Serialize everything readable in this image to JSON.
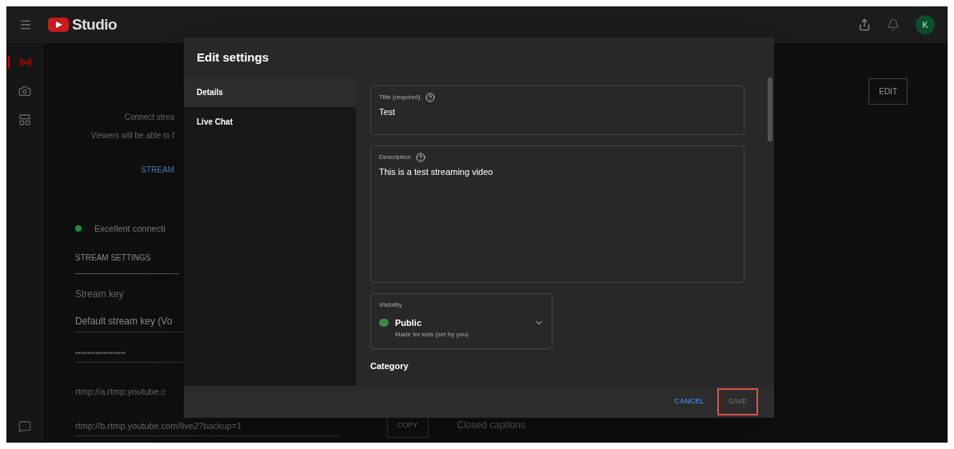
{
  "topbar": {
    "logo": "Studio",
    "avatar": "K"
  },
  "nav": [
    {
      "kind": "live",
      "selected": true
    },
    {
      "kind": "camera",
      "selected": false
    },
    {
      "kind": "manager",
      "selected": false
    }
  ],
  "stream": {
    "intro": [
      "Connect strea",
      "Viewers will be able to f"
    ],
    "link": "STREAM",
    "status": "Excellent connecti",
    "tab": "STREAM SETTINGS",
    "key_heading": "Stream key",
    "key_value": "Default stream key (Vo",
    "masked_key": "••••••••••••••••••••",
    "primary_url": "rtmp://a.rtmp.youtube.c",
    "backup_url": "rtmp://b.rtmp.youtube.com/live2?backup=1",
    "copy": "COPY",
    "captions": "Closed captions",
    "edit": "EDIT"
  },
  "dialog": {
    "title": "Edit settings",
    "tabs": [
      {
        "label": "Details",
        "selected": true
      },
      {
        "label": "Live Chat",
        "selected": false
      }
    ],
    "fields": [
      {
        "label": "Title (required)",
        "value": "Test",
        "kind": "line"
      },
      {
        "label": "Description",
        "value": "This is a test streaming video",
        "kind": "area"
      }
    ],
    "visibility": {
      "label": "Visibility",
      "value": "Public",
      "note": "Made for kids (set by you)"
    },
    "category": "Category",
    "buttons": {
      "cancel": "CANCEL",
      "save": "SAVE"
    }
  }
}
